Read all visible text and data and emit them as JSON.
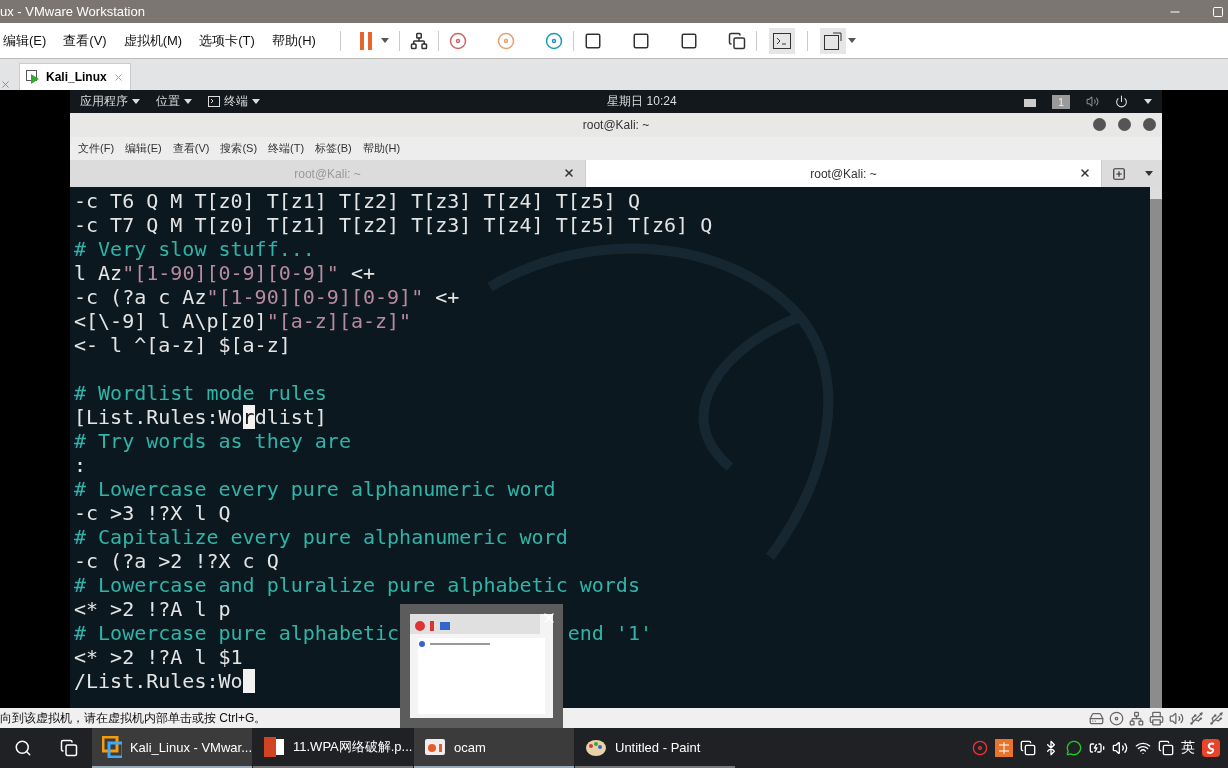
{
  "window": {
    "title": "ux - VMware Workstation"
  },
  "menu": [
    "编辑(E)",
    "查看(V)",
    "虚拟机(M)",
    "选项卡(T)",
    "帮助(H)"
  ],
  "vm_tabs": [
    {
      "label": "Kali_Linux",
      "selected": true
    }
  ],
  "guest": {
    "top_bar": {
      "menus": [
        "应用程序",
        "位置",
        "终端"
      ],
      "clock": "星期日 10:24",
      "workspace": "1"
    },
    "terminal": {
      "title": "root@Kali: ~",
      "menu": [
        "文件(F)",
        "编辑(E)",
        "查看(V)",
        "搜索(S)",
        "终端(T)",
        "标签(B)",
        "帮助(H)"
      ],
      "tabs": [
        {
          "label": "root@Kali: ~",
          "selected": false
        },
        {
          "label": "root@Kali: ~",
          "selected": true
        }
      ],
      "lines": [
        [
          {
            "kind": "plain",
            "text": "-c T6 Q M T[z0] T[z1] T[z2] T[z3] T[z4] T[z5] Q"
          }
        ],
        [
          {
            "kind": "plain",
            "text": "-c T7 Q M T[z0] T[z1] T[z2] T[z3] T[z4] T[z5] T[z6] Q"
          }
        ],
        [
          {
            "kind": "comment",
            "text": "# Very slow stuff..."
          }
        ],
        [
          {
            "kind": "plain",
            "text": "l Az"
          },
          {
            "kind": "string",
            "text": "\"[1-90][0-9][0-9]\""
          },
          {
            "kind": "plain",
            "text": " <+"
          }
        ],
        [
          {
            "kind": "plain",
            "text": "-c (?a c Az"
          },
          {
            "kind": "string",
            "text": "\"[1-90][0-9][0-9]\""
          },
          {
            "kind": "plain",
            "text": " <+"
          }
        ],
        [
          {
            "kind": "plain",
            "text": "<[\\-9] l A\\p[z0]"
          },
          {
            "kind": "string",
            "text": "\"[a-z][a-z]\""
          }
        ],
        [
          {
            "kind": "plain",
            "text": "<- l ^[a-z] $[a-z]"
          }
        ],
        [
          {
            "kind": "blank"
          }
        ],
        [
          {
            "kind": "comment",
            "text": "# Wordlist mode rules"
          }
        ],
        [
          {
            "kind": "plain",
            "text": "[List.Rules:Wo"
          },
          {
            "kind": "cursor",
            "text": "r"
          },
          {
            "kind": "plain",
            "text": "dlist]"
          }
        ],
        [
          {
            "kind": "comment",
            "text": "# Try words as they are"
          }
        ],
        [
          {
            "kind": "plain",
            "text": ":"
          }
        ],
        [
          {
            "kind": "comment",
            "text": "# Lowercase every pure alphanumeric word"
          }
        ],
        [
          {
            "kind": "plain",
            "text": "-c >3 !?X l Q"
          }
        ],
        [
          {
            "kind": "comment",
            "text": "# Capitalize every pure alphanumeric word"
          }
        ],
        [
          {
            "kind": "plain",
            "text": "-c (?a >2 !?X c Q"
          }
        ],
        [
          {
            "kind": "comment",
            "text": "# Lowercase and pluralize pure alphabetic words"
          }
        ],
        [
          {
            "kind": "plain",
            "text": "<* >2 !?A l p"
          }
        ],
        [
          {
            "kind": "comment",
            "text": "# Lowercase pure alphabetic"
          },
          {
            "kind": "tail",
            "text": "end '1'"
          }
        ],
        [
          {
            "kind": "plain",
            "text": "<* >2 !?A l $1"
          }
        ],
        [
          {
            "kind": "plain",
            "text": "/List.Rules:Wo"
          },
          {
            "kind": "cursor"
          }
        ]
      ]
    }
  },
  "status_bar": {
    "hint": "向到该虚拟机，请在虚拟机内部单击或按 Ctrl+G。"
  },
  "taskbar": {
    "items": [
      {
        "label": "Kali_Linux - VMwar...",
        "kind": "vmware",
        "selected": true
      },
      {
        "label": "11.WPA网络破解.p...",
        "kind": "slides",
        "selected": false
      },
      {
        "label": "ocam",
        "kind": "recorder",
        "selected": true
      },
      {
        "label": "Untitled - Paint",
        "kind": "paint",
        "selected": false
      }
    ],
    "ime": "英"
  }
}
